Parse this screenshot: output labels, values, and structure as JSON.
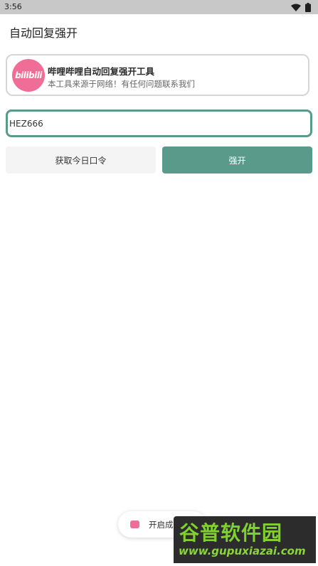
{
  "status_bar": {
    "time": "3:56",
    "icons": [
      "wifi-icon",
      "battery-icon"
    ]
  },
  "app_bar": {
    "title": "自动回复强开"
  },
  "info_card": {
    "logo_text": "bilibili",
    "title": "哔哩哔哩自动回复强开工具",
    "subtitle": "本工具来源于网络！有任何问题联系我们"
  },
  "code_input": {
    "value": "HEZ666"
  },
  "buttons": {
    "get_code": "获取今日口令",
    "force_open": "强开"
  },
  "toast": {
    "text": "开启成功!"
  },
  "watermark": {
    "title": "谷普软件园",
    "url": "www.gupuxiazai.com"
  },
  "colors": {
    "accent": "#5a9a8b",
    "brand_pink": "#f06d98",
    "status_bar": "#c8c8c8"
  }
}
